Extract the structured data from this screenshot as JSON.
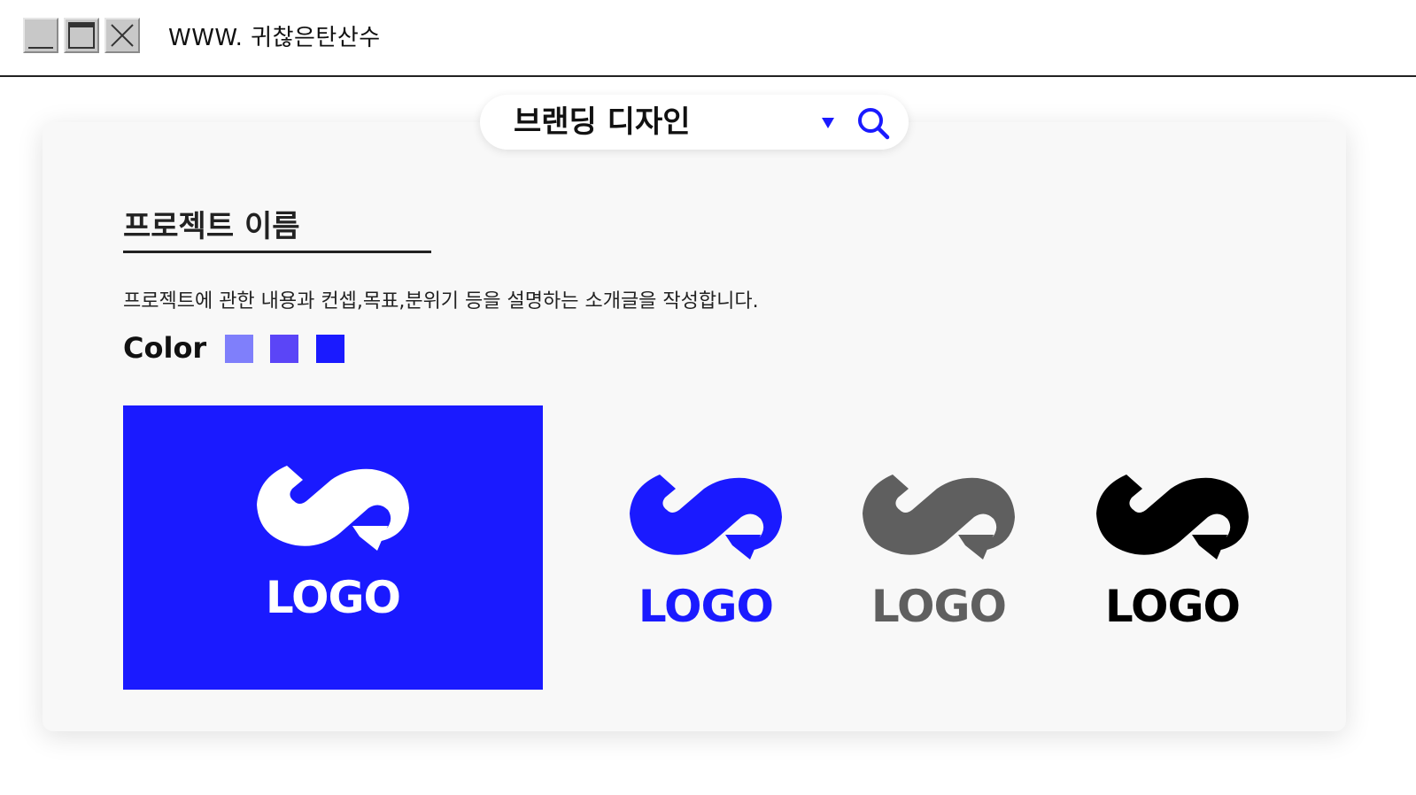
{
  "window": {
    "title": "WWW. 귀찮은탄산수"
  },
  "search": {
    "value": "브랜딩 디자인"
  },
  "project": {
    "title": "프로젝트 이름",
    "description": "프로젝트에 관한 내용과 컨셉,목표,분위기 등을 설명하는 소개글을 작성합니다."
  },
  "colors": {
    "label": "Color",
    "swatches": [
      "#7f7ffb",
      "#5b45f7",
      "#1a1aff"
    ]
  },
  "logos": {
    "panel_background": "#1a1aff",
    "items": [
      {
        "text": "LOGO",
        "color": "#ffffff"
      },
      {
        "text": "LOGO",
        "color": "#1a1aff"
      },
      {
        "text": "LOGO",
        "color": "#5f5f5f"
      },
      {
        "text": "LOGO",
        "color": "#000000"
      }
    ]
  }
}
